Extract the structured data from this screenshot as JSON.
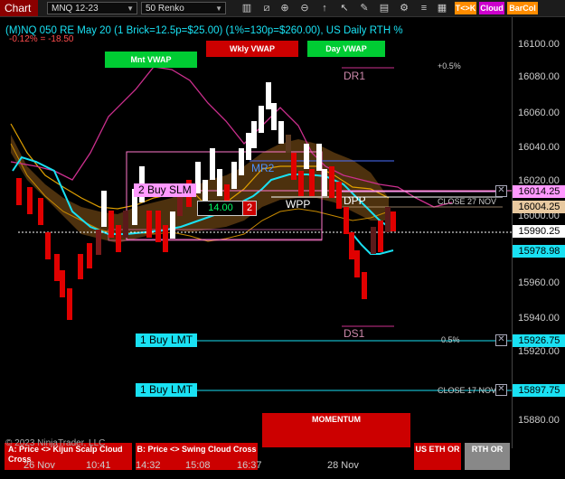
{
  "toolbar": {
    "title": "Chart",
    "instrument": "MNQ 12-23",
    "period": "50 Renko",
    "badges": [
      {
        "label": "T<>K",
        "color": "#ff8c00"
      },
      {
        "label": "Cloud",
        "color": "#cc00cc"
      },
      {
        "label": "BarCol",
        "color": "#ff8c00"
      }
    ],
    "icons": [
      "bars-icon",
      "zoom-in-icon",
      "zoom-out-icon",
      "arrow-up-icon",
      "pointer-icon",
      "pencil-icon",
      "chart-trader-icon",
      "gear-icon",
      "alert-icon",
      "layout-icon",
      "lines-icon"
    ]
  },
  "header": {
    "title": "(M)NQ 050 RE May 20 (1 Brick=12.5p=$25.00) (1%=130p=$260.00), US Daily RTH %",
    "change": "-0.12% = -18.50"
  },
  "top_buttons": {
    "mnt_vwap": "Mnt VWAP",
    "wkly_vwap": "Wkly VWAP",
    "day_vwap": "Day VWAP"
  },
  "levels": {
    "dr1": "DR1",
    "ds1": "DS1",
    "mr2": "MR2",
    "wpp": "WPP",
    "dpp": "DPP",
    "pct_top": "+0.5%",
    "pct_bottom": "0.5%",
    "close_27": "CLOSE 27 NOV",
    "close_17": "CLOSE 17 NOV"
  },
  "orders": {
    "buy_slm": "2 Buy SLM",
    "buy_slm_price": "14.00",
    "buy_slm_qty": "2",
    "buy_lmt_1": "1 Buy LMT",
    "buy_lmt_2": "1 Buy LMT"
  },
  "y_axis": {
    "ticks": [
      "16100.00",
      "16080.00",
      "16060.00",
      "16040.00",
      "16020.00",
      "16000.00",
      "15960.00",
      "15940.00",
      "15920.00",
      "15880.00"
    ],
    "price_boxes": [
      {
        "value": "16014.25",
        "color": "#ff99ff"
      },
      {
        "value": "16004.25",
        "color": "#e8c9a0"
      },
      {
        "value": "15990.25",
        "color": "#ffffff"
      },
      {
        "value": "15978.98",
        "color": "#19e1f3"
      },
      {
        "value": "15926.75",
        "color": "#19e1f3"
      },
      {
        "value": "15897.75",
        "color": "#19e1f3"
      }
    ]
  },
  "x_axis": {
    "ticks": [
      "26 Nov",
      "10:41",
      "14:32",
      "15:08",
      "16:37",
      "28 Nov"
    ]
  },
  "bottom_buttons": {
    "kijun": "A: Price <> Kijun Scalp Cloud Cross",
    "swing": "B: Price <> Swing Cloud Cross",
    "momentum": "MOMENTUM",
    "us_eth": "US ETH OR",
    "rth": "RTH OR"
  },
  "copyright": "© 2023 NinjaTrader, LLC"
}
